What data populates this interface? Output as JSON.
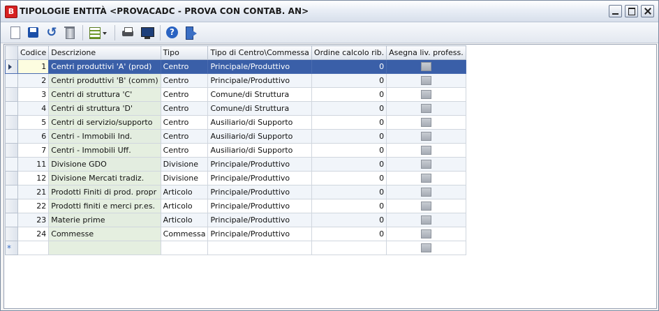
{
  "window": {
    "app_icon_letter": "B",
    "title": "TIPOLOGIE ENTITÀ <PROVACADC - PROVA CON CONTAB. AN>",
    "controls": [
      "minimize-icon",
      "maximize-icon",
      "close-icon"
    ]
  },
  "toolbar": {
    "buttons": [
      "new-document-icon",
      "save-icon",
      "undo-icon",
      "delete-icon",
      "grid-layout-icon",
      "print-icon",
      "preview-icon",
      "help-icon",
      "exit-icon"
    ],
    "undo_glyph": "↺"
  },
  "grid": {
    "columns": [
      "Codice",
      "Descrizione",
      "Tipo",
      "Tipo di Centro\\Commessa",
      "Ordine calcolo rib.",
      "Asegna liv. profess."
    ],
    "rows": [
      {
        "codice": "1",
        "descrizione": "Centri produttivi 'A' (prod)",
        "tipo": "Centro",
        "tipo_centro": "Principale/Produttivo",
        "ordine": "0"
      },
      {
        "codice": "2",
        "descrizione": "Centri produttivi 'B' (comm)",
        "tipo": "Centro",
        "tipo_centro": "Principale/Produttivo",
        "ordine": "0"
      },
      {
        "codice": "3",
        "descrizione": "Centri di struttura 'C'",
        "tipo": "Centro",
        "tipo_centro": "Comune/di Struttura",
        "ordine": "0"
      },
      {
        "codice": "4",
        "descrizione": "Centri di struttura 'D'",
        "tipo": "Centro",
        "tipo_centro": "Comune/di Struttura",
        "ordine": "0"
      },
      {
        "codice": "5",
        "descrizione": "Centri di servizio/supporto",
        "tipo": "Centro",
        "tipo_centro": "Ausiliario/di Supporto",
        "ordine": "0"
      },
      {
        "codice": "6",
        "descrizione": "Centri - Immobili Ind.",
        "tipo": "Centro",
        "tipo_centro": "Ausiliario/di Supporto",
        "ordine": "0"
      },
      {
        "codice": "7",
        "descrizione": "Centri - Immobili Uff.",
        "tipo": "Centro",
        "tipo_centro": "Ausiliario/di Supporto",
        "ordine": "0"
      },
      {
        "codice": "11",
        "descrizione": "Divisione GDO",
        "tipo": "Divisione",
        "tipo_centro": "Principale/Produttivo",
        "ordine": "0"
      },
      {
        "codice": "12",
        "descrizione": "Divisione Mercati tradiz.",
        "tipo": "Divisione",
        "tipo_centro": "Principale/Produttivo",
        "ordine": "0"
      },
      {
        "codice": "21",
        "descrizione": "Prodotti Finiti di prod. propr",
        "tipo": "Articolo",
        "tipo_centro": "Principale/Produttivo",
        "ordine": "0"
      },
      {
        "codice": "22",
        "descrizione": "Prodotti finiti e merci pr.es.",
        "tipo": "Articolo",
        "tipo_centro": "Principale/Produttivo",
        "ordine": "0"
      },
      {
        "codice": "23",
        "descrizione": "Materie prime",
        "tipo": "Articolo",
        "tipo_centro": "Principale/Produttivo",
        "ordine": "0"
      },
      {
        "codice": "24",
        "descrizione": "Commesse",
        "tipo": "Commessa",
        "tipo_centro": "Principale/Produttivo",
        "ordine": "0"
      }
    ],
    "new_row_marker": "*",
    "selected_row_index": 0
  }
}
